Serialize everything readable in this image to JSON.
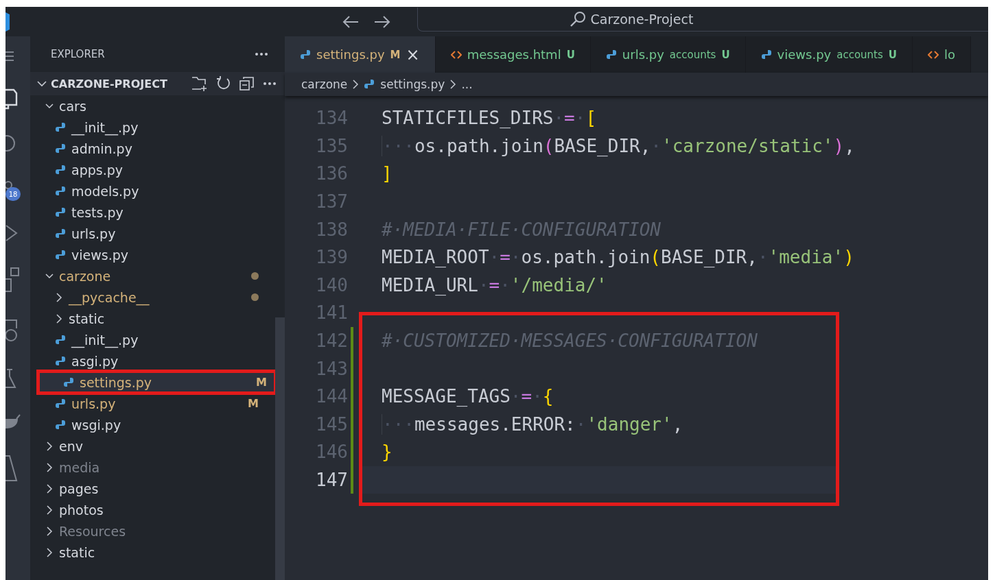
{
  "title_bar": {
    "search": "Carzone-Project"
  },
  "activity_bar": {
    "account_badge": "18"
  },
  "explorer": {
    "title": "EXPLORER",
    "project": {
      "name": "CARZONE-PROJECT",
      "expanded": true
    },
    "tree": [
      {
        "name": "cars",
        "kind": "folder",
        "expanded": true,
        "selected": false,
        "children": [
          {
            "name": "__init__.py",
            "kind": "py",
            "selected": false
          },
          {
            "name": "admin.py",
            "kind": "py",
            "selected": false
          },
          {
            "name": "apps.py",
            "kind": "py",
            "selected": false
          },
          {
            "name": "models.py",
            "kind": "py",
            "selected": false
          },
          {
            "name": "tests.py",
            "kind": "py",
            "selected": false
          },
          {
            "name": "urls.py",
            "kind": "py",
            "selected": false
          },
          {
            "name": "views.py",
            "kind": "py",
            "selected": false
          }
        ]
      },
      {
        "name": "carzone",
        "kind": "folder",
        "expanded": true,
        "selected": false,
        "color": "#d5b37a",
        "dot": true,
        "children": [
          {
            "name": "__pycache__",
            "kind": "folder",
            "expanded": false,
            "selected": false,
            "color": "#d5b37a",
            "dot": true
          },
          {
            "name": "static",
            "kind": "folder",
            "expanded": false,
            "selected": false
          },
          {
            "name": "__init__.py",
            "kind": "py",
            "selected": false
          },
          {
            "name": "asgi.py",
            "kind": "py",
            "selected": false
          },
          {
            "name": "settings.py",
            "kind": "py",
            "selected": true,
            "color": "#d5b37a",
            "badge": "M",
            "annotated": true
          },
          {
            "name": "urls.py",
            "kind": "py",
            "selected": false,
            "color": "#d5b37a",
            "badge": "M"
          },
          {
            "name": "wsgi.py",
            "kind": "py",
            "selected": false
          }
        ]
      },
      {
        "name": "env",
        "kind": "folder",
        "expanded": false,
        "selected": false
      },
      {
        "name": "media",
        "kind": "folder",
        "expanded": false,
        "selected": false,
        "color": "#7f848e"
      },
      {
        "name": "pages",
        "kind": "folder",
        "expanded": false,
        "selected": false
      },
      {
        "name": "photos",
        "kind": "folder",
        "expanded": false,
        "selected": false
      },
      {
        "name": "Resources",
        "kind": "folder",
        "expanded": false,
        "selected": false,
        "color": "#7f848e"
      },
      {
        "name": "static",
        "kind": "folder",
        "expanded": false,
        "selected": false
      }
    ]
  },
  "tabs": [
    {
      "label": "settings.py",
      "kind": "py",
      "status": "M",
      "color": "#d5b37a",
      "selected": true,
      "close": "×"
    },
    {
      "label": "messages.html",
      "kind": "html",
      "status": "U",
      "color": "#73c991",
      "selected": false
    },
    {
      "label": "urls.py",
      "kind": "py",
      "detail": "accounts",
      "status": "U",
      "color": "#73c991",
      "selected": false
    },
    {
      "label": "views.py",
      "kind": "py",
      "detail": "accounts",
      "status": "U",
      "color": "#73c991",
      "selected": false
    },
    {
      "label": "lo",
      "kind": "html",
      "color": "#73c991",
      "selected": false
    }
  ],
  "breadcrumb": [
    {
      "text": "carzone",
      "kind": "folder"
    },
    {
      "text": "settings.py",
      "kind": "py"
    },
    {
      "text": "...",
      "kind": "more"
    }
  ],
  "code": [
    {
      "number": "134",
      "tokens": [
        {
          "text": "STATICFILES_DIRS",
          "kind": "id"
        },
        {
          "text": "·",
          "kind": "ws"
        },
        {
          "text": "=",
          "kind": "op"
        },
        {
          "text": "·",
          "kind": "ws"
        },
        {
          "text": "[",
          "kind": "br1"
        }
      ]
    },
    {
      "number": "135",
      "tokens": [
        {
          "text": "···",
          "kind": "indent"
        },
        {
          "text": "os.path.join",
          "kind": "id"
        },
        {
          "text": "(",
          "kind": "br2"
        },
        {
          "text": "BASE_DIR,",
          "kind": "id"
        },
        {
          "text": "·",
          "kind": "ws"
        },
        {
          "text": "'carzone/static'",
          "kind": "str"
        },
        {
          "text": ")",
          "kind": "br2"
        },
        {
          "text": ",",
          "kind": "id"
        }
      ]
    },
    {
      "number": "136",
      "tokens": [
        {
          "text": "]",
          "kind": "br1"
        }
      ]
    },
    {
      "number": "137"
    },
    {
      "number": "138",
      "tokens": [
        {
          "text": "#·MEDIA·FILE·CONFIGURATION",
          "kind": "comment"
        }
      ]
    },
    {
      "number": "139",
      "tokens": [
        {
          "text": "MEDIA_ROOT",
          "kind": "id"
        },
        {
          "text": "·",
          "kind": "ws"
        },
        {
          "text": "=",
          "kind": "op"
        },
        {
          "text": "·",
          "kind": "ws"
        },
        {
          "text": "os.path.join",
          "kind": "id"
        },
        {
          "text": "(",
          "kind": "br1"
        },
        {
          "text": "BASE_DIR,",
          "kind": "id"
        },
        {
          "text": "·",
          "kind": "ws"
        },
        {
          "text": "'media'",
          "kind": "str"
        },
        {
          "text": ")",
          "kind": "br1"
        }
      ]
    },
    {
      "number": "140",
      "tokens": [
        {
          "text": "MEDIA_URL",
          "kind": "id"
        },
        {
          "text": "·",
          "kind": "ws"
        },
        {
          "text": "=",
          "kind": "op"
        },
        {
          "text": "·",
          "kind": "ws"
        },
        {
          "text": "'/media/'",
          "kind": "str"
        }
      ]
    },
    {
      "number": "141"
    },
    {
      "number": "142",
      "added": true,
      "annotated": true,
      "tokens": [
        {
          "text": "#·CUSTOMIZED·MESSAGES·CONFIGURATION",
          "kind": "comment"
        }
      ]
    },
    {
      "number": "143",
      "added": true,
      "annotated": true
    },
    {
      "number": "144",
      "added": true,
      "annotated": true,
      "tokens": [
        {
          "text": "MESSAGE_TAGS",
          "kind": "id"
        },
        {
          "text": "·",
          "kind": "ws"
        },
        {
          "text": "=",
          "kind": "op"
        },
        {
          "text": "·",
          "kind": "ws"
        },
        {
          "text": "{",
          "kind": "br1"
        }
      ]
    },
    {
      "number": "145",
      "added": true,
      "annotated": true,
      "tokens": [
        {
          "text": "···",
          "kind": "indent"
        },
        {
          "text": "messages.ERROR:",
          "kind": "id"
        },
        {
          "text": "·",
          "kind": "ws"
        },
        {
          "text": "'danger'",
          "kind": "str"
        },
        {
          "text": ",",
          "kind": "id"
        }
      ]
    },
    {
      "number": "146",
      "added": true,
      "annotated": true,
      "tokens": [
        {
          "text": "}",
          "kind": "br1"
        }
      ]
    },
    {
      "number": "147",
      "added": true,
      "annotated": true,
      "current": true
    }
  ]
}
